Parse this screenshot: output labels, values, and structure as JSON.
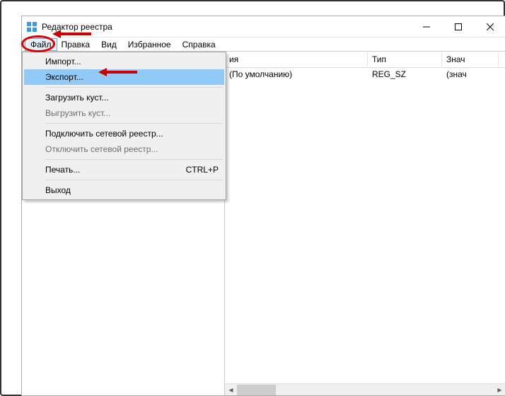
{
  "window": {
    "title": "Редактор реестра"
  },
  "menubar": {
    "items": [
      "Файл",
      "Правка",
      "Вид",
      "Избранное",
      "Справка"
    ]
  },
  "dropdown": {
    "items": [
      {
        "label": "Импорт...",
        "enabled": true
      },
      {
        "label": "Экспорт...",
        "enabled": true,
        "highlight": true
      },
      {
        "sep": true
      },
      {
        "label": "Загрузить куст...",
        "enabled": true
      },
      {
        "label": "Выгрузить куст...",
        "enabled": false
      },
      {
        "sep": true
      },
      {
        "label": "Подключить сетевой реестр...",
        "enabled": true
      },
      {
        "label": "Отключить сетевой реестр...",
        "enabled": false
      },
      {
        "sep": true
      },
      {
        "label": "Печать...",
        "enabled": true,
        "shortcut": "CTRL+P"
      },
      {
        "sep": true
      },
      {
        "label": "Выход",
        "enabled": true
      }
    ]
  },
  "list": {
    "headers": [
      "ия",
      "Тип",
      "Знач"
    ],
    "rows": [
      {
        "name": "(По умолчанию)",
        "type": "REG_SZ",
        "value": "(знач"
      }
    ]
  }
}
